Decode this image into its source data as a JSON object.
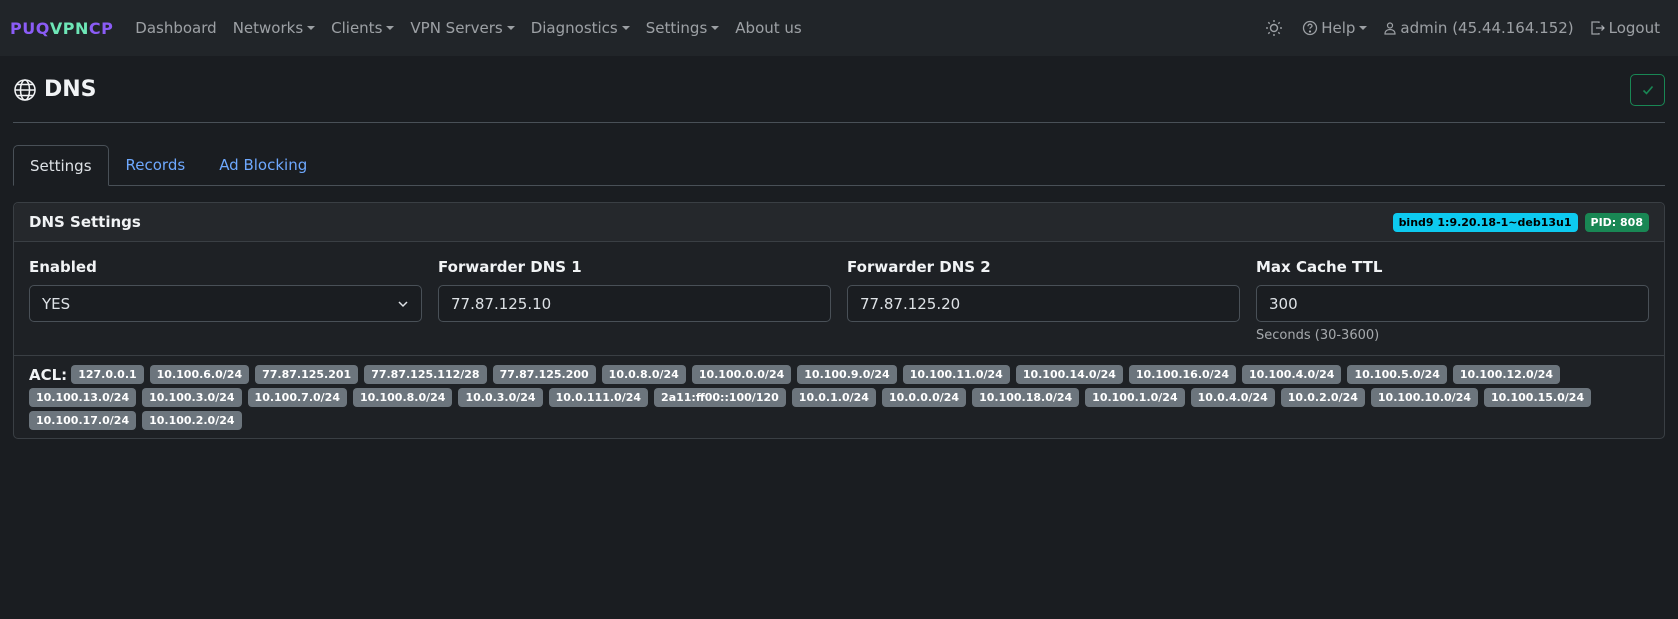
{
  "navbar": {
    "brand": {
      "part1": "PUQ",
      "part2": "VPN",
      "part3": "CP"
    },
    "items": [
      {
        "label": "Dashboard",
        "dropdown": false
      },
      {
        "label": "Networks",
        "dropdown": true
      },
      {
        "label": "Clients",
        "dropdown": true
      },
      {
        "label": "VPN Servers",
        "dropdown": true
      },
      {
        "label": "Diagnostics",
        "dropdown": true
      },
      {
        "label": "Settings",
        "dropdown": true
      },
      {
        "label": "About us",
        "dropdown": false
      }
    ],
    "help_label": "Help",
    "user_label": "admin (45.44.164.152)",
    "logout_label": "Logout"
  },
  "page": {
    "title": "DNS"
  },
  "tabs": [
    {
      "label": "Settings",
      "active": true
    },
    {
      "label": "Records",
      "active": false
    },
    {
      "label": "Ad Blocking",
      "active": false
    }
  ],
  "card": {
    "title": "DNS Settings",
    "version_badge": "bind9 1:9.20.18-1~deb13u1",
    "pid_badge": "PID: 808"
  },
  "fields": {
    "enabled": {
      "label": "Enabled",
      "value": "YES"
    },
    "forwarder1": {
      "label": "Forwarder DNS 1",
      "value": "77.87.125.10"
    },
    "forwarder2": {
      "label": "Forwarder DNS 2",
      "value": "77.87.125.20"
    },
    "max_ttl": {
      "label": "Max Cache TTL",
      "value": "300",
      "help": "Seconds (30-3600)"
    }
  },
  "acl": {
    "label": "ACL:",
    "entries": [
      "127.0.0.1",
      "10.100.6.0/24",
      "77.87.125.201",
      "77.87.125.112/28",
      "77.87.125.200",
      "10.0.8.0/24",
      "10.100.0.0/24",
      "10.100.9.0/24",
      "10.100.11.0/24",
      "10.100.14.0/24",
      "10.100.16.0/24",
      "10.100.4.0/24",
      "10.100.5.0/24",
      "10.100.12.0/24",
      "10.100.13.0/24",
      "10.100.3.0/24",
      "10.100.7.0/24",
      "10.100.8.0/24",
      "10.0.3.0/24",
      "10.0.111.0/24",
      "2a11:ff00::100/120",
      "10.0.1.0/24",
      "10.0.0.0/24",
      "10.100.18.0/24",
      "10.100.1.0/24",
      "10.0.4.0/24",
      "10.0.2.0/24",
      "10.100.10.0/24",
      "10.100.15.0/24",
      "10.100.17.0/24",
      "10.100.2.0/24"
    ]
  },
  "colors": {
    "success": "#198754",
    "info": "#0dcaf0",
    "link": "#6ea8fe",
    "acl_badge": "#6c757d"
  },
  "icons": [
    "globe-icon",
    "check-icon",
    "sun-icon",
    "help-circle-icon",
    "user-icon",
    "logout-icon",
    "chevron-down-icon"
  ]
}
